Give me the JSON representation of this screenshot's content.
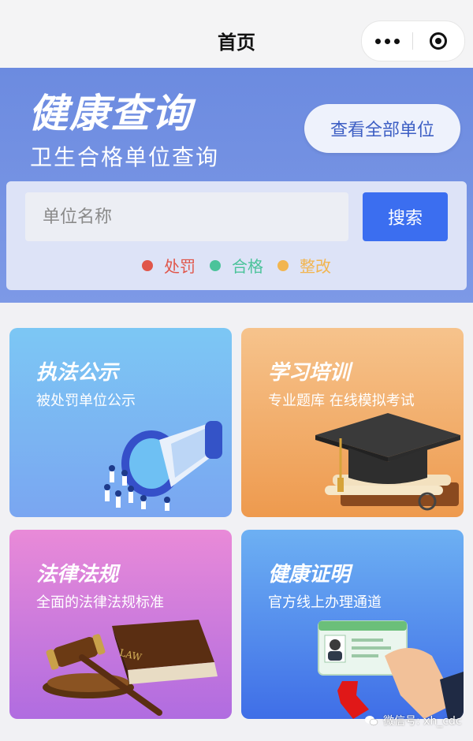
{
  "nav": {
    "title": "首页"
  },
  "header": {
    "title": "健康查询",
    "subtitle": "卫生合格单位查询",
    "view_all_label": "查看全部单位"
  },
  "search": {
    "placeholder": "单位名称",
    "value": "",
    "button_label": "搜索"
  },
  "legend": [
    {
      "label": "处罚",
      "color": "#e0564a"
    },
    {
      "label": "合格",
      "color": "#4bc39a"
    },
    {
      "label": "整改",
      "color": "#f2b54f"
    }
  ],
  "cards": [
    {
      "title": "执法公示",
      "subtitle": "被处罚单位公示",
      "icon": "megaphone-icon"
    },
    {
      "title": "学习培训",
      "subtitle": "专业题库 在线模拟考试",
      "icon": "graduation-cap-icon"
    },
    {
      "title": "法律法规",
      "subtitle": "全面的法律法规标准",
      "icon": "gavel-icon"
    },
    {
      "title": "健康证明",
      "subtitle": "官方线上办理通道",
      "icon": "health-certificate-icon"
    }
  ],
  "law_book_spine": "LAW",
  "watermark": "微信号: xh_cdc"
}
